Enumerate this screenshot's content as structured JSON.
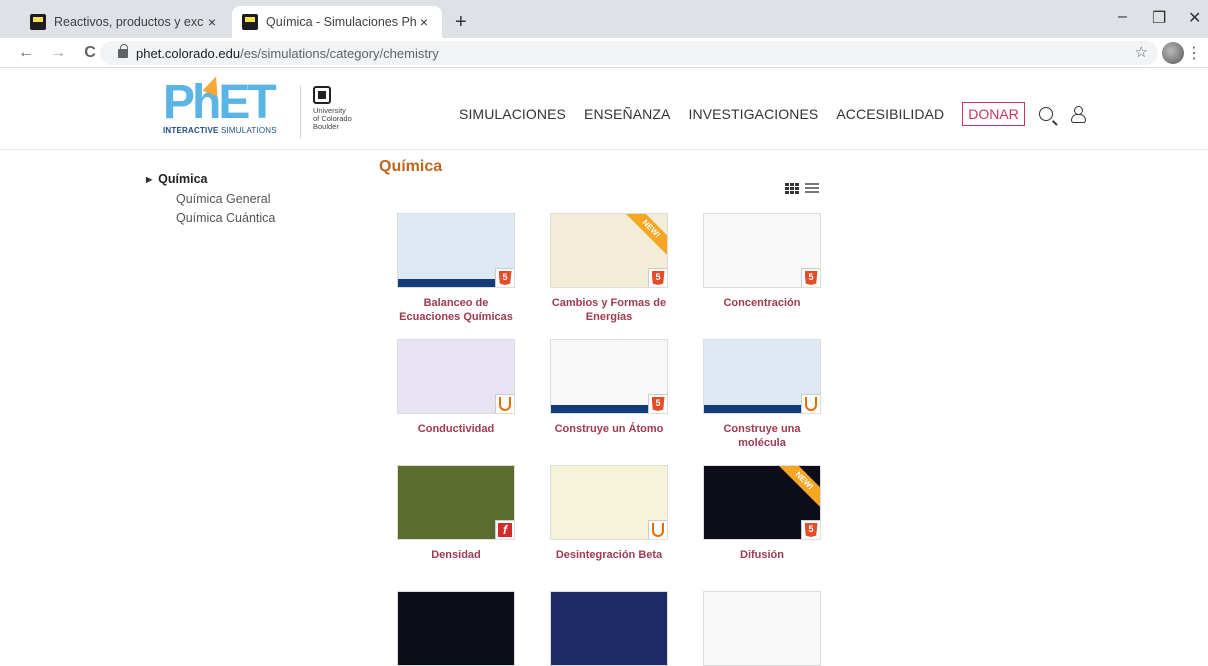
{
  "browser": {
    "tabs": [
      {
        "title": "Reactivos, productos y excedente",
        "close": "×"
      },
      {
        "title": "Química - Simulaciones PhET",
        "close": "×"
      }
    ],
    "new_tab": "+",
    "window_controls": {
      "minimize": "–",
      "restore": "❐",
      "close": "✕"
    },
    "nav": {
      "back": "←",
      "forward": "→",
      "reload": "C"
    },
    "url": {
      "host": "phet.colorado.edu",
      "path": "/es/simulations/category/chemistry"
    },
    "bookmark_icon": "☆",
    "menu_icon": "⋮"
  },
  "header": {
    "logo": {
      "letters": "PhET",
      "sub_bold": "INTERACTIVE",
      "sub_light": " SIMULATIONS"
    },
    "cu": {
      "text": [
        "University",
        "of Colorado",
        "Boulder"
      ]
    },
    "nav": [
      "SIMULACIONES",
      "ENSEÑANZA",
      "INVESTIGACIONES",
      "ACCESIBILIDAD"
    ],
    "donate": "DONAR"
  },
  "sidebar": {
    "caret": "▶",
    "heading": "Química",
    "items": [
      "Química General",
      "Química Cuántica"
    ]
  },
  "main": {
    "title": "Química",
    "sims": [
      {
        "name_lines": [
          "Balanceo de",
          "Ecuaciones Químicas"
        ],
        "tech": "html5",
        "new": false
      },
      {
        "name_lines": [
          "Cambios y Formas de",
          "Energías"
        ],
        "tech": "html5",
        "new": true
      },
      {
        "name_lines": [
          "Concentración",
          ""
        ],
        "tech": "html5",
        "new": false
      },
      {
        "name_lines": [
          "Conductividad",
          ""
        ],
        "tech": "java",
        "new": false
      },
      {
        "name_lines": [
          "Construye un Átomo",
          ""
        ],
        "tech": "html5",
        "new": false
      },
      {
        "name_lines": [
          "Construye una",
          "molécula"
        ],
        "tech": "java",
        "new": false
      },
      {
        "name_lines": [
          "Densidad",
          ""
        ],
        "tech": "flash",
        "new": false
      },
      {
        "name_lines": [
          "Desintegración Beta",
          ""
        ],
        "tech": "java",
        "new": false
      },
      {
        "name_lines": [
          "Difusión",
          ""
        ],
        "tech": "html5",
        "new": true
      }
    ],
    "badge_labels": {
      "html5": "5",
      "flash": "f"
    },
    "new_label": "NEW!"
  },
  "colors": {
    "accent_title": "#c0651d",
    "sim_name": "#a03a4f",
    "donate": "#c8365b"
  }
}
